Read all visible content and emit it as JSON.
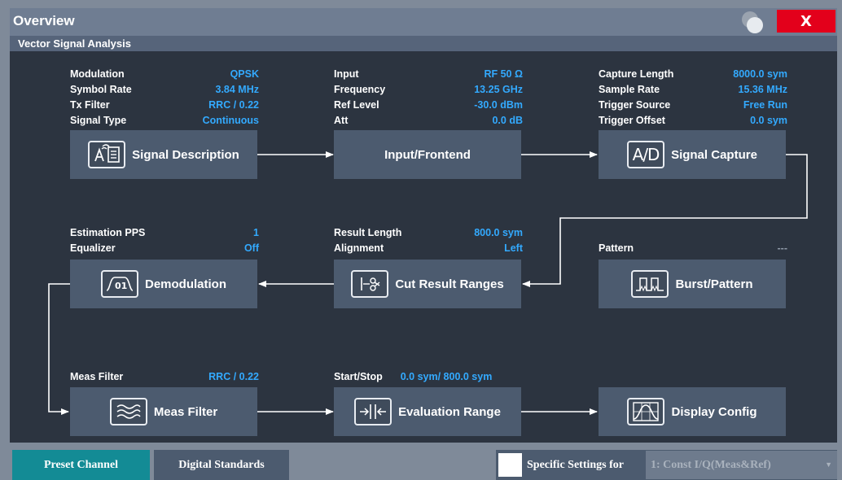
{
  "window": {
    "title": "Overview",
    "close_label": "X"
  },
  "panel": {
    "title": "Vector Signal Analysis"
  },
  "signal_description": {
    "label": "Signal Description",
    "params": [
      {
        "label": "Modulation",
        "value": "QPSK"
      },
      {
        "label": "Symbol Rate",
        "value": "3.84 MHz"
      },
      {
        "label": "Tx Filter",
        "value": "RRC / 0.22"
      },
      {
        "label": "Signal Type",
        "value": "Continuous"
      }
    ]
  },
  "input_frontend": {
    "label": "Input/Frontend",
    "params": [
      {
        "label": "Input",
        "value": "RF 50 Ω"
      },
      {
        "label": "Frequency",
        "value": "13.25 GHz"
      },
      {
        "label": "Ref Level",
        "value": "-30.0 dBm"
      },
      {
        "label": "Att",
        "value": "0.0 dB"
      }
    ]
  },
  "signal_capture": {
    "label": "Signal Capture",
    "icon_text": "A/D",
    "params": [
      {
        "label": "Capture Length",
        "value": "8000.0 sym"
      },
      {
        "label": "Sample Rate",
        "value": "15.36 MHz"
      },
      {
        "label": "Trigger Source",
        "value": "Free Run"
      },
      {
        "label": "Trigger Offset",
        "value": "0.0 sym"
      }
    ]
  },
  "demodulation": {
    "label": "Demodulation",
    "params": [
      {
        "label": "Estimation PPS",
        "value": "1"
      },
      {
        "label": "Equalizer",
        "value": "Off"
      }
    ]
  },
  "cut_result_ranges": {
    "label": "Cut Result Ranges",
    "params": [
      {
        "label": "Result Length",
        "value": "800.0 sym"
      },
      {
        "label": "Alignment",
        "value": "Left"
      }
    ]
  },
  "burst_pattern": {
    "label": "Burst/Pattern",
    "params": [
      {
        "label": "Pattern",
        "value": "---"
      }
    ]
  },
  "meas_filter": {
    "label": "Meas Filter",
    "params": [
      {
        "label": "Meas Filter",
        "value": "RRC / 0.22"
      }
    ]
  },
  "evaluation_range": {
    "label": "Evaluation Range",
    "params": [
      {
        "label": "Start/Stop",
        "value": "0.0 sym/ 800.0 sym"
      }
    ]
  },
  "display_config": {
    "label": "Display Config"
  },
  "bottom_bar": {
    "preset_channel": "Preset Channel",
    "digital_standards": "Digital Standards",
    "specific_settings_label": "Specific Settings for",
    "specific_settings_value": "1: Const I/Q(Meas&Ref)"
  }
}
